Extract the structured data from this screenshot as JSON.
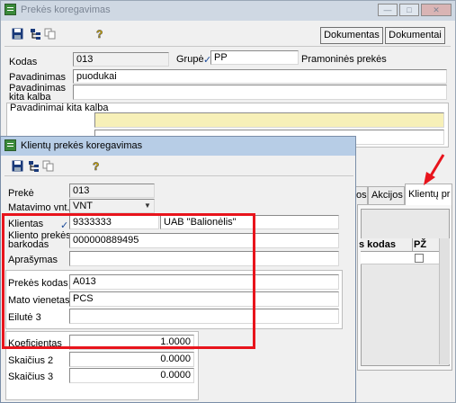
{
  "back_window": {
    "title": "Prekės koregavimas",
    "buttons": {
      "dokumentas": "Dokumentas",
      "dokumentai": "Dokumentai"
    },
    "labels": {
      "kodas": "Kodas",
      "grupe": "Grupė",
      "pavadinimas": "Pavadinimas",
      "pavadinimas_kita_line1": "Pavadinimas",
      "pavadinimas_kita_line2": "kita kalba",
      "pavadinimai_kita": "Pavadinimai kita kalba"
    },
    "values": {
      "kodas": "013",
      "grupe_code": "PP",
      "grupe_name": "Pramoninės prekės",
      "pavadinimas": "puodukai",
      "pavadinimas_kita": ""
    },
    "tabs": [
      "os",
      "Akcijos",
      "Klientų pr"
    ],
    "grid_header": {
      "kodas": "s kodas",
      "pz": "PŽ"
    }
  },
  "front_window": {
    "title": "Klientų prekės koregavimas",
    "labels": {
      "preke": "Prekė",
      "matavimo": "Matavimo vnt.",
      "klientas": "Klientas",
      "kliento_barkodas_line1": "Kliento prekės",
      "kliento_barkodas_line2": "barkodas",
      "aprasymas": "Aprašymas",
      "prekes_kodas": "Prekės kodas",
      "mato_vienetas": "Mato vienetas",
      "eilute3": "Eilutė 3",
      "koeficientas": "Koeficientas",
      "skaicius2": "Skaičius 2",
      "skaicius3": "Skaičius 3"
    },
    "values": {
      "preke": "013",
      "matavimo": "VNT",
      "klientas_code": "9333333",
      "klientas_name": "UAB \"Balionėlis\"",
      "barkodas": "000000889495",
      "aprasymas": "",
      "prekes_kodas": "A013",
      "mato_vienetas": "PCS",
      "eilute3": "",
      "koeficientas": "1.0000",
      "skaicius2": "0.0000",
      "skaicius3": "0.0000"
    }
  },
  "colors": {
    "highlight": "#e8141c",
    "yellow_field": "#f7f0b8",
    "check": "#1a4a9a"
  }
}
